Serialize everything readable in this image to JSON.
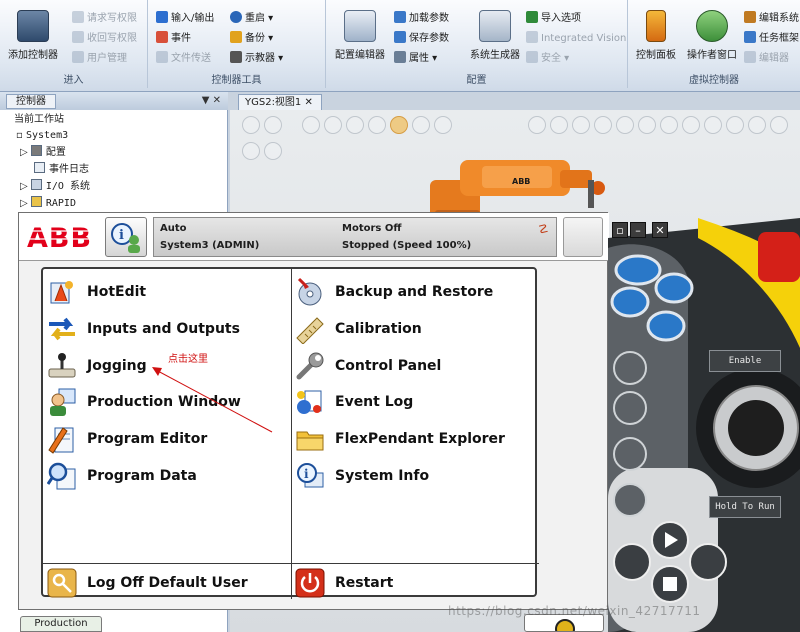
{
  "ribbon": {
    "groups": {
      "input": {
        "title": "进入",
        "add_controller": "添加控制器",
        "request_write": "请求写权限",
        "revoke_write": "收回写权限",
        "user_mgmt": "用户管理"
      },
      "tools": {
        "title": "控制器工具",
        "io": "输入/输出",
        "events": "事件",
        "file_transfer": "文件传送",
        "restart": "重启",
        "backup": "备份",
        "teach_pendant": "示教器"
      },
      "config": {
        "title": "配置",
        "config_editor": "配置编辑器",
        "load_params": "加载参数",
        "save_params": "保存参数",
        "properties": "属性",
        "system_builder": "系统生成器",
        "import_options": "导入选项",
        "integrated_vision": "Integrated Vision",
        "safety": "安全"
      },
      "virtual": {
        "title": "虚拟控制器",
        "control_panel": "控制面板",
        "operator_window": "操作者窗口",
        "edit_system": "编辑系统",
        "task_frames": "任务框架",
        "edit_more": "编辑器"
      }
    }
  },
  "left_panel": {
    "tab": "控制器",
    "tree": {
      "root": "当前工作站",
      "system": "System3",
      "config": "配置",
      "event_log": "事件日志",
      "io_system": "I/O 系统",
      "rapid": "RAPID"
    }
  },
  "viewport": {
    "tab": "YGS2:视图1"
  },
  "flexpendant": {
    "status": {
      "mode": "Auto",
      "system": "System3 (ADMIN)",
      "motors": "Motors Off",
      "state": "Stopped (Speed 100%)"
    },
    "menu": {
      "left": [
        "HotEdit",
        "Inputs and Outputs",
        "Jogging",
        "Production Window",
        "Program Editor",
        "Program Data"
      ],
      "right": [
        "Backup and Restore",
        "Calibration",
        "Control Panel",
        "Event Log",
        "FlexPendant Explorer",
        "System Info"
      ],
      "logoff": "Log Off Default User",
      "restart": "Restart"
    },
    "annotation": "点击这里",
    "bottom_tab": "Production"
  },
  "joystick": {
    "enable": "Enable",
    "hold_to_run": "Hold To Run"
  },
  "watermark": "https://blog.csdn.net/weixin_42717711",
  "colors": {
    "abb_red": "#e2001a",
    "annotation_red": "#d01010",
    "robot_orange": "#f07c17",
    "joystick_yellow": "#f5d10a"
  },
  "icons": {
    "hotedit": "hotedit-icon",
    "io": "io-arrows-icon",
    "jogging": "joystick-icon",
    "production": "user-window-icon",
    "program_editor": "pencil-document-icon",
    "program_data": "magnifier-document-icon",
    "backup": "disc-arrow-icon",
    "calibration": "ruler-icon",
    "control_panel": "wrench-icon",
    "event_log": "event-log-icon",
    "explorer": "folder-icon",
    "system_info": "info-icon",
    "logoff": "key-icon",
    "restart": "power-icon"
  }
}
